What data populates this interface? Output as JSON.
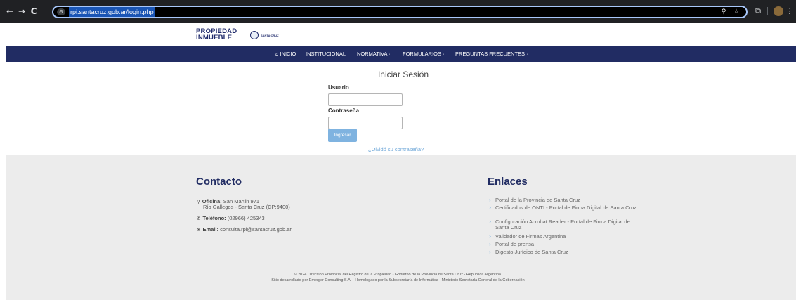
{
  "browser": {
    "url": "rpi.santacruz.gob.ar/login.php",
    "back_icon": "←",
    "forward_icon": "→",
    "reload_icon": "C",
    "zoom_icon": "⚲",
    "star_icon": "☆",
    "extensions_icon": "⧉",
    "menu_icon": "⋮"
  },
  "header": {
    "logo_line1": "PROPIEDAD",
    "logo_line2": "INMUEBLE",
    "logo_gov": "SANTA CRUZ"
  },
  "nav": {
    "home_icon": "⌂",
    "items": [
      {
        "label": "INICIO"
      },
      {
        "label": "INSTITUCIONAL"
      },
      {
        "label": "NORMATIVA"
      },
      {
        "label": "FORMULARIOS"
      },
      {
        "label": "PREGUNTAS FRECUENTES"
      }
    ],
    "dropdown_marker": "·"
  },
  "login": {
    "title": "Iniciar Sesión",
    "user_label": "Usuario",
    "user_value": "",
    "password_label": "Contraseña",
    "password_value": "",
    "submit_label": "Ingresar",
    "forgot_link": "¿Olvidó su contraseña?"
  },
  "footer": {
    "contact_title": "Contacto",
    "office_icon": "⚲",
    "office_label": "Oficina:",
    "office_line1": "San Martín 971",
    "office_line2": "Río Gallegos - Santa Cruz (CP:9400)",
    "phone_icon": "✆",
    "phone_label": "Teléfono:",
    "phone_value": "(02966) 425343",
    "email_icon": "✉",
    "email_label": "Email:",
    "email_value": "consulta.rpi@santacruz.gob.ar",
    "links_title": "Enlaces",
    "link_arrow": "›",
    "links": [
      {
        "label": "Portal de la Provincia de Santa Cruz"
      },
      {
        "label": "Certificados de ONTI - Portal de Firma Digital de Santa Cruz"
      },
      {
        "label": "Configuración Acrobat Reader - Portal de Firma Digital de Santa Cruz"
      },
      {
        "label": "Validador de Firmas Argentina"
      },
      {
        "label": "Portal de prensa"
      },
      {
        "label": "Digesto Jurídico de Santa Cruz"
      }
    ],
    "copyright": "© 2024 Dirección Provincial del Registro de la Propiedad - Gobierno de la Provincia de Santa Cruz - República Argentina.",
    "credits": "Sitio desarrollado por Emerger Consulting S.A. - Homologado por la Subsecretaría de Informática - Ministerio Secretaría General de la Gobernación"
  }
}
